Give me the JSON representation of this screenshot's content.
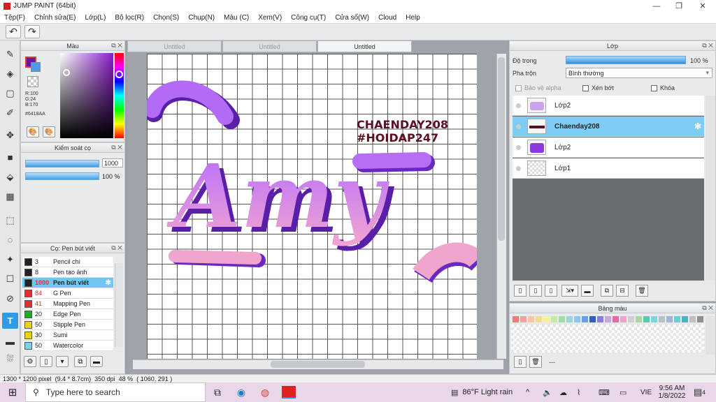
{
  "window": {
    "title": "JUMP PAINT (64bit)",
    "minimize": "—",
    "restore": "❐",
    "close": "✕"
  },
  "menu": [
    "Tệp(F)",
    "Chỉnh sửa(E)",
    "Lớp(L)",
    "Bộ lọc(R)",
    "Chọn(S)",
    "Chụp(N)",
    "Màu (C)",
    "Xem(V)",
    "Công cụ(T)",
    "Cửa sổ(W)",
    "Cloud",
    "Help"
  ],
  "toolbar": {
    "undo": "↶",
    "redo": "↷"
  },
  "tools": [
    "✎",
    "◈",
    "▢",
    "✐",
    "✥",
    "■",
    "⬙",
    "▦",
    "⬚",
    "◌",
    "✦",
    "☐",
    "⊘",
    "T",
    "▬",
    "⛆"
  ],
  "color_panel": {
    "title": "Màu",
    "r": "R:100",
    "g": "G:24",
    "b": "B:170",
    "hex": "#6418AA",
    "colors": {
      "foreground": "#6418AA",
      "background": "#4f9be6"
    }
  },
  "brush_control": {
    "title": "Kiểm soát cọ",
    "size": "1000",
    "opacity": "100 %"
  },
  "brush_panel": {
    "title": "Cọ: Pen bút viết",
    "items": [
      {
        "size": "3",
        "name": "Pencil chì",
        "color": "#222222"
      },
      {
        "size": "8",
        "name": "Pen tạo ảnh",
        "color": "#222222"
      },
      {
        "size": "1000",
        "name": "Pen bút viết",
        "color": "#222222"
      },
      {
        "size": "84",
        "name": "G Pen",
        "color": "#e03030"
      },
      {
        "size": "41",
        "name": "Mapping Pen",
        "color": "#e03030"
      },
      {
        "size": "20",
        "name": "Edge Pen",
        "color": "#22aa22"
      },
      {
        "size": "50",
        "name": "Stipple Pen",
        "color": "#e8d020"
      },
      {
        "size": "30",
        "name": "Sumi",
        "color": "#e8d020"
      },
      {
        "size": "50",
        "name": "Watercolor",
        "color": "#7fd0f0"
      }
    ]
  },
  "canvas": {
    "tabs": [
      "Untitled",
      "Untitled",
      "Untitled"
    ],
    "artwork": {
      "main_word": "Amy",
      "line1": "CHAENDAY208",
      "line2": "#HOIDAP247"
    }
  },
  "layers": {
    "title": "Lớp",
    "opacity_label": "Độ trong",
    "opacity_value": "100 %",
    "blend_label": "Pha trộn",
    "blend_value": "Bình thường",
    "protect_alpha": "Bảo vệ alpha",
    "clip": "Xén bớt",
    "lock": "Khóa",
    "items": [
      "Lớp2",
      "Chaenday208",
      "Lớp2",
      "Lớp1"
    ]
  },
  "palette": {
    "title": "Bảng màu",
    "colors": [
      "#f07b7b",
      "#f4a0a0",
      "#f7c6a5",
      "#f1dd8c",
      "#f6f09a",
      "#c8e9a0",
      "#9be0a6",
      "#97d6df",
      "#8bc7ef",
      "#6a9fe0",
      "#2f5fbf",
      "#8d7fd6",
      "#c9a6e0",
      "#e46aa7",
      "#f3a1c5",
      "#cfcfcf",
      "#a7d8a0",
      "#5cc7b5",
      "#7cd6e0",
      "#b7c0c8",
      "#a0b4d8",
      "#6cd0d0",
      "#3dbbc0",
      "#c0c0c0",
      "#8f8f8f"
    ],
    "footer_text": "---"
  },
  "status": {
    "size": "1300 * 1200 pixel",
    "dims": "(9.4 * 8.7cm)",
    "dpi": "350 dpi",
    "zoom": "48 %",
    "coords": "( 1060, 291 )"
  },
  "taskbar": {
    "search_placeholder": "Type here to search",
    "weather": "86°F  Light rain",
    "lang": "VIE",
    "time": "9:56 AM",
    "date": "1/8/2022",
    "notifications": "4"
  }
}
